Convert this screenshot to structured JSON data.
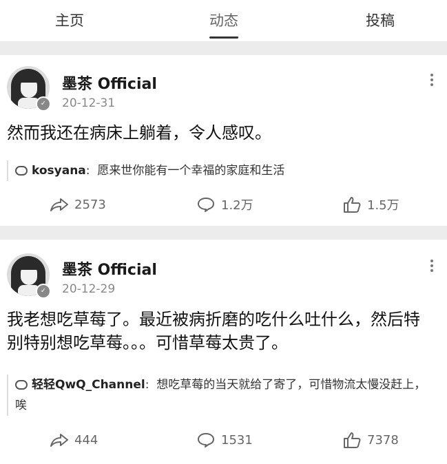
{
  "tabs": [
    {
      "label": "主页"
    },
    {
      "label": "动态"
    },
    {
      "label": "投稿"
    }
  ],
  "posts": [
    {
      "author": "墨茶 Official",
      "date": "20-12-31",
      "text": "然而我还在病床上躺着，令人感叹。",
      "comment": {
        "user": "kosyana",
        "sep": ":",
        "text": "愿来世你能有一个幸福的家庭和生活"
      },
      "shares": "2573",
      "comments": "1.2万",
      "likes": "1.5万"
    },
    {
      "author": "墨茶 Official",
      "date": "20-12-29",
      "text": "我老想吃草莓了。最近被病折磨的吃什么吐什么，然后特别特别想吃草莓。。。可惜草莓太贵了。",
      "comment": {
        "user": "轻轻QwQ_Channel",
        "sep": ":",
        "text": "想吃草莓的当天就给了寄了，可惜物流太慢没赶上，唉"
      },
      "shares": "444",
      "comments": "1531",
      "likes": "7378"
    }
  ]
}
